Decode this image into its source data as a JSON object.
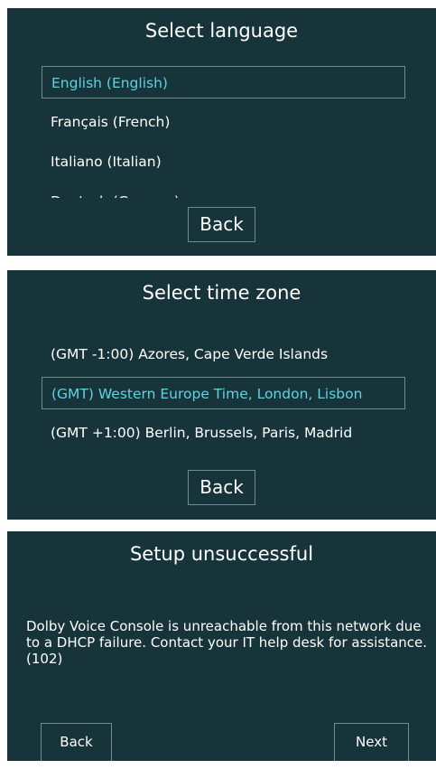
{
  "language_screen": {
    "title": "Select language",
    "items": [
      {
        "label": "English (English)",
        "selected": true
      },
      {
        "label": "Français (French)",
        "selected": false
      },
      {
        "label": "Italiano (Italian)",
        "selected": false
      },
      {
        "label": "Deutsch (German)",
        "selected": false
      }
    ],
    "back_label": "Back"
  },
  "timezone_screen": {
    "title": "Select time zone",
    "items": [
      {
        "label": "(GMT -1:00) Azores, Cape Verde Islands",
        "selected": false
      },
      {
        "label": "(GMT) Western Europe Time, London, Lisbon",
        "selected": true
      },
      {
        "label": "(GMT +1:00) Berlin, Brussels, Paris, Madrid",
        "selected": false
      }
    ],
    "back_label": "Back"
  },
  "setup_screen": {
    "title": "Setup unsuccessful",
    "message": "Dolby Voice Console is unreachable from this network due to a DHCP failure. Contact your IT help desk for assistance. (102)",
    "back_label": "Back",
    "next_label": "Next"
  },
  "colors": {
    "panel_background": "#17343a",
    "selected_text": "#5fd3e0",
    "border": "#6e8c92",
    "text": "#ffffff"
  }
}
